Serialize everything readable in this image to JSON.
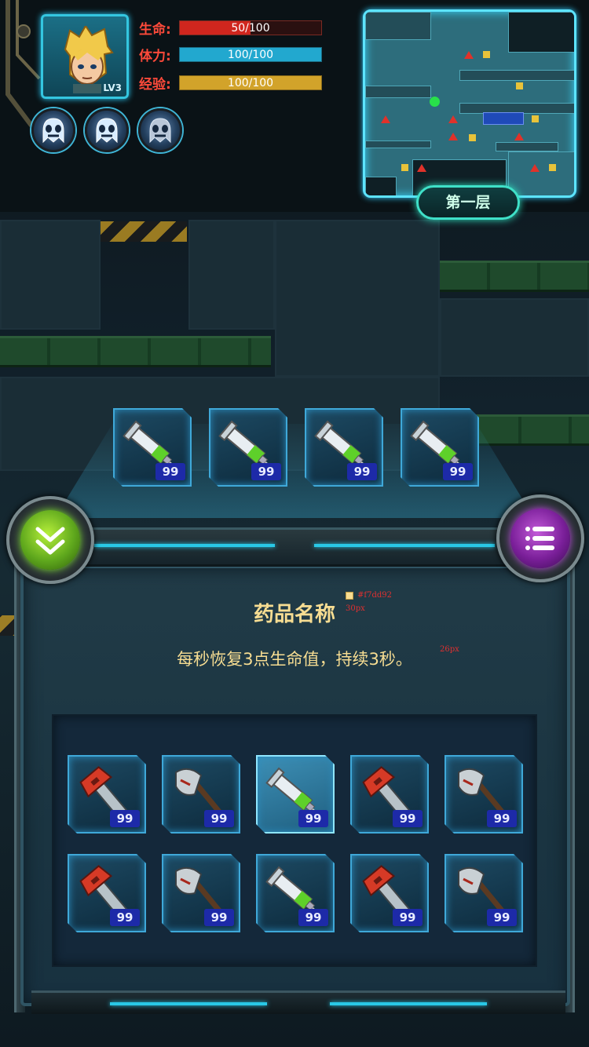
{
  "player": {
    "level_label": "LV3",
    "stats": [
      {
        "label": "生命:",
        "value_text": "50/100",
        "fraction": 0.5,
        "color": "#d0261e",
        "label_color": "#ff4a3a"
      },
      {
        "label": "体力:",
        "value_text": "100/100",
        "fraction": 1.0,
        "color": "#22a8cf",
        "label_color": "#ff4a3a"
      },
      {
        "label": "经验:",
        "value_text": "100/100",
        "fraction": 1.0,
        "color": "#d2a32a",
        "label_color": "#ff4a3a"
      }
    ],
    "skills": [
      {
        "icon": "ghost-skull-icon"
      },
      {
        "icon": "ghost-skull-icon"
      },
      {
        "icon": "ghost-skull-icon"
      }
    ]
  },
  "minimap": {
    "floor_label": "第一层"
  },
  "quick_slots": [
    {
      "item": "syringe-icon",
      "count": "99"
    },
    {
      "item": "syringe-icon",
      "count": "99"
    },
    {
      "item": "syringe-icon",
      "count": "99"
    },
    {
      "item": "syringe-icon",
      "count": "99"
    }
  ],
  "panel": {
    "title": "药品名称",
    "description": "每秒恢复3点生命值，持续3秒。",
    "annotations": {
      "color_note": "#f7dd92",
      "title_size_note": "30px",
      "desc_size_note": "26px"
    },
    "inventory": [
      {
        "item": "wrench-icon",
        "count": "99"
      },
      {
        "item": "axe-icon",
        "count": "99"
      },
      {
        "item": "syringe-icon",
        "count": "99",
        "selected": true
      },
      {
        "item": "wrench-icon",
        "count": "99"
      },
      {
        "item": "axe-icon",
        "count": "99"
      },
      {
        "item": "wrench-icon",
        "count": "99"
      },
      {
        "item": "axe-icon",
        "count": "99"
      },
      {
        "item": "syringe-icon",
        "count": "99"
      },
      {
        "item": "wrench-icon",
        "count": "99"
      },
      {
        "item": "axe-icon",
        "count": "99"
      }
    ]
  },
  "colors": {
    "accent_cyan": "#29c8e6",
    "title_gold": "#f7dd92",
    "count_badge": "#1d2aa8"
  }
}
